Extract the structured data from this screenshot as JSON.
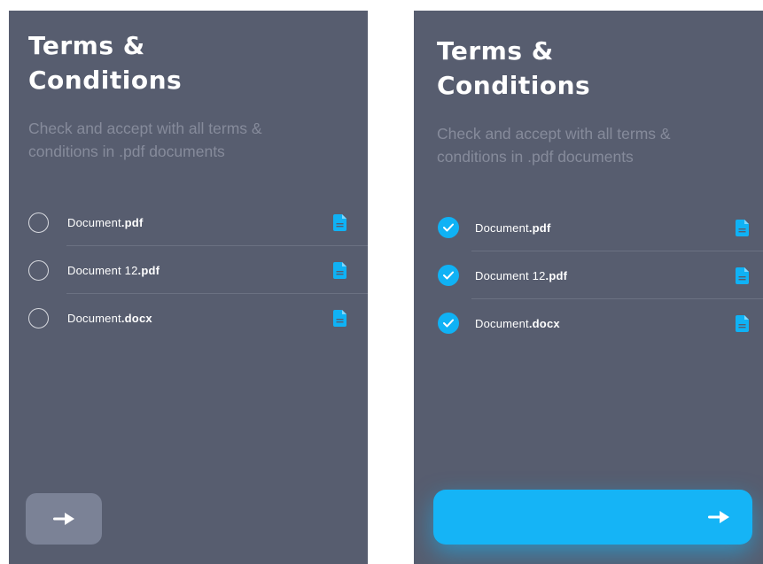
{
  "screens": [
    {
      "state": "unchecked",
      "title_line1": "Terms &",
      "title_line2": "Conditions",
      "subtitle": "Check and accept with all terms & conditions in .pdf documents",
      "documents": [
        {
          "name": "Document",
          "ext": ".pdf",
          "checked": false
        },
        {
          "name": "Document 12",
          "ext": ".pdf",
          "checked": false
        },
        {
          "name": "Document",
          "ext": ".docx",
          "checked": false
        }
      ],
      "next_icon": "arrow-right-icon"
    },
    {
      "state": "checked",
      "title_line1": "Terms &",
      "title_line2": "Conditions",
      "subtitle": "Check and accept with all terms & conditions in .pdf documents",
      "documents": [
        {
          "name": "Document",
          "ext": ".pdf",
          "checked": true
        },
        {
          "name": "Document 12",
          "ext": ".pdf",
          "checked": true
        },
        {
          "name": "Document",
          "ext": ".docx",
          "checked": true
        }
      ],
      "next_icon": "arrow-right-icon"
    }
  ],
  "colors": {
    "panel_bg": "#575d6f",
    "accent": "#0fb2f5",
    "subtitle": "#868b9b",
    "button_inactive": "#7b8296",
    "file_icon": "#0fb2f5"
  },
  "icons": {
    "file": "document-file-icon",
    "check": "checkmark-icon",
    "next": "arrow-right-icon"
  }
}
